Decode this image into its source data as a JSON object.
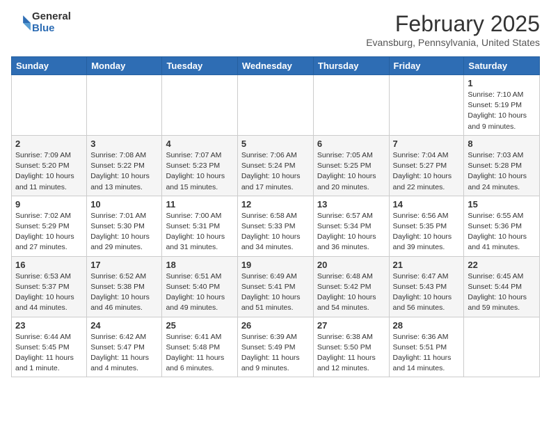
{
  "header": {
    "logo_general": "General",
    "logo_blue": "Blue",
    "month_year": "February 2025",
    "location": "Evansburg, Pennsylvania, United States"
  },
  "days_of_week": [
    "Sunday",
    "Monday",
    "Tuesday",
    "Wednesday",
    "Thursday",
    "Friday",
    "Saturday"
  ],
  "weeks": [
    [
      {
        "day": "",
        "info": ""
      },
      {
        "day": "",
        "info": ""
      },
      {
        "day": "",
        "info": ""
      },
      {
        "day": "",
        "info": ""
      },
      {
        "day": "",
        "info": ""
      },
      {
        "day": "",
        "info": ""
      },
      {
        "day": "1",
        "info": "Sunrise: 7:10 AM\nSunset: 5:19 PM\nDaylight: 10 hours\nand 9 minutes."
      }
    ],
    [
      {
        "day": "2",
        "info": "Sunrise: 7:09 AM\nSunset: 5:20 PM\nDaylight: 10 hours\nand 11 minutes."
      },
      {
        "day": "3",
        "info": "Sunrise: 7:08 AM\nSunset: 5:22 PM\nDaylight: 10 hours\nand 13 minutes."
      },
      {
        "day": "4",
        "info": "Sunrise: 7:07 AM\nSunset: 5:23 PM\nDaylight: 10 hours\nand 15 minutes."
      },
      {
        "day": "5",
        "info": "Sunrise: 7:06 AM\nSunset: 5:24 PM\nDaylight: 10 hours\nand 17 minutes."
      },
      {
        "day": "6",
        "info": "Sunrise: 7:05 AM\nSunset: 5:25 PM\nDaylight: 10 hours\nand 20 minutes."
      },
      {
        "day": "7",
        "info": "Sunrise: 7:04 AM\nSunset: 5:27 PM\nDaylight: 10 hours\nand 22 minutes."
      },
      {
        "day": "8",
        "info": "Sunrise: 7:03 AM\nSunset: 5:28 PM\nDaylight: 10 hours\nand 24 minutes."
      }
    ],
    [
      {
        "day": "9",
        "info": "Sunrise: 7:02 AM\nSunset: 5:29 PM\nDaylight: 10 hours\nand 27 minutes."
      },
      {
        "day": "10",
        "info": "Sunrise: 7:01 AM\nSunset: 5:30 PM\nDaylight: 10 hours\nand 29 minutes."
      },
      {
        "day": "11",
        "info": "Sunrise: 7:00 AM\nSunset: 5:31 PM\nDaylight: 10 hours\nand 31 minutes."
      },
      {
        "day": "12",
        "info": "Sunrise: 6:58 AM\nSunset: 5:33 PM\nDaylight: 10 hours\nand 34 minutes."
      },
      {
        "day": "13",
        "info": "Sunrise: 6:57 AM\nSunset: 5:34 PM\nDaylight: 10 hours\nand 36 minutes."
      },
      {
        "day": "14",
        "info": "Sunrise: 6:56 AM\nSunset: 5:35 PM\nDaylight: 10 hours\nand 39 minutes."
      },
      {
        "day": "15",
        "info": "Sunrise: 6:55 AM\nSunset: 5:36 PM\nDaylight: 10 hours\nand 41 minutes."
      }
    ],
    [
      {
        "day": "16",
        "info": "Sunrise: 6:53 AM\nSunset: 5:37 PM\nDaylight: 10 hours\nand 44 minutes."
      },
      {
        "day": "17",
        "info": "Sunrise: 6:52 AM\nSunset: 5:38 PM\nDaylight: 10 hours\nand 46 minutes."
      },
      {
        "day": "18",
        "info": "Sunrise: 6:51 AM\nSunset: 5:40 PM\nDaylight: 10 hours\nand 49 minutes."
      },
      {
        "day": "19",
        "info": "Sunrise: 6:49 AM\nSunset: 5:41 PM\nDaylight: 10 hours\nand 51 minutes."
      },
      {
        "day": "20",
        "info": "Sunrise: 6:48 AM\nSunset: 5:42 PM\nDaylight: 10 hours\nand 54 minutes."
      },
      {
        "day": "21",
        "info": "Sunrise: 6:47 AM\nSunset: 5:43 PM\nDaylight: 10 hours\nand 56 minutes."
      },
      {
        "day": "22",
        "info": "Sunrise: 6:45 AM\nSunset: 5:44 PM\nDaylight: 10 hours\nand 59 minutes."
      }
    ],
    [
      {
        "day": "23",
        "info": "Sunrise: 6:44 AM\nSunset: 5:45 PM\nDaylight: 11 hours\nand 1 minute."
      },
      {
        "day": "24",
        "info": "Sunrise: 6:42 AM\nSunset: 5:47 PM\nDaylight: 11 hours\nand 4 minutes."
      },
      {
        "day": "25",
        "info": "Sunrise: 6:41 AM\nSunset: 5:48 PM\nDaylight: 11 hours\nand 6 minutes."
      },
      {
        "day": "26",
        "info": "Sunrise: 6:39 AM\nSunset: 5:49 PM\nDaylight: 11 hours\nand 9 minutes."
      },
      {
        "day": "27",
        "info": "Sunrise: 6:38 AM\nSunset: 5:50 PM\nDaylight: 11 hours\nand 12 minutes."
      },
      {
        "day": "28",
        "info": "Sunrise: 6:36 AM\nSunset: 5:51 PM\nDaylight: 11 hours\nand 14 minutes."
      },
      {
        "day": "",
        "info": ""
      }
    ]
  ]
}
